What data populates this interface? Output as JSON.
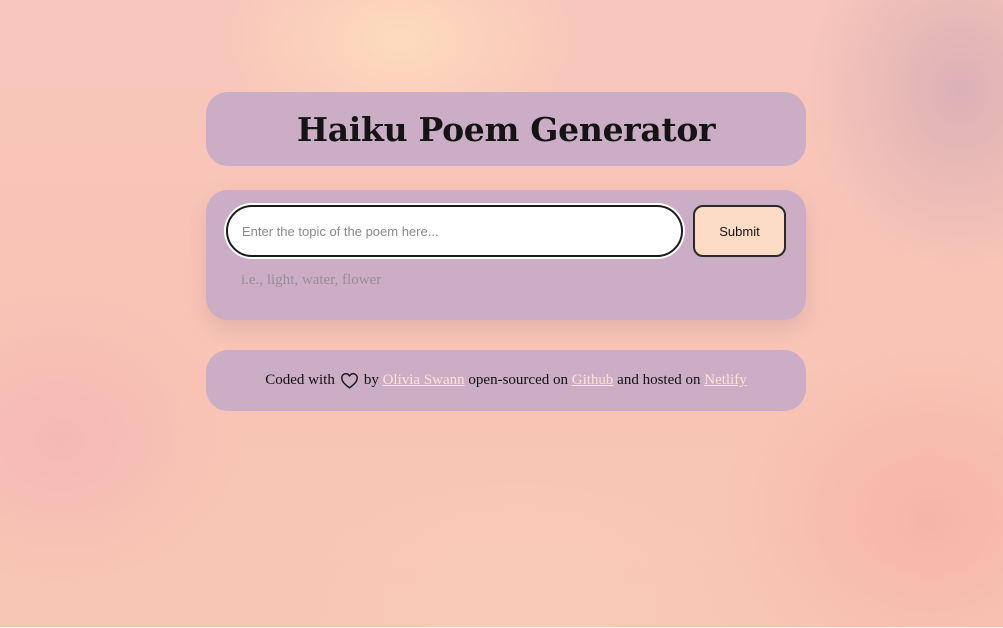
{
  "header": {
    "title": "Haiku Poem Generator"
  },
  "form": {
    "input_placeholder": "Enter the topic of the poem here...",
    "input_value": "",
    "submit_label": "Submit",
    "hint": "i.e., light, water, flower"
  },
  "footer": {
    "prefix": "Coded with",
    "heart_icon": "heart-outline-icon",
    "by": "by",
    "author_link": "Olivia Swann",
    "middle": "open-sourced on",
    "github_link": "Github",
    "hosted": "and hosted on",
    "netlify_link": "Netlify"
  },
  "colors": {
    "card_background": "#cbaec5",
    "button_background": "#fcdcc7",
    "link_color": "#fde3d3",
    "page_background": "#f8c6bb"
  }
}
